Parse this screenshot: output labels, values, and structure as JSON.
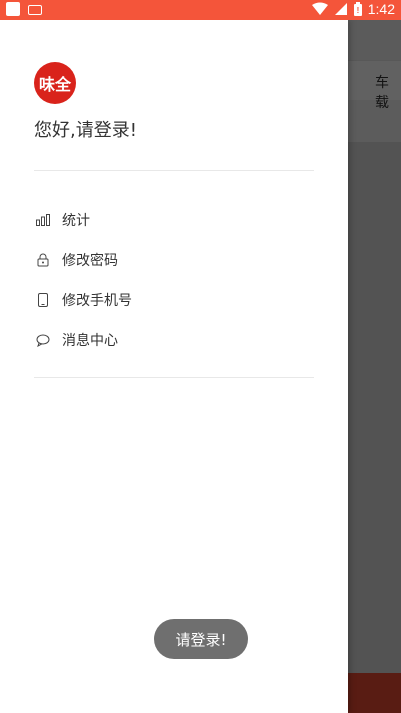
{
  "status_bar": {
    "time": "1:42",
    "icons": [
      "wifi-icon",
      "signal-icon",
      "battery-icon"
    ]
  },
  "background": {
    "tab_label": "车载"
  },
  "drawer": {
    "avatar_text": "味全",
    "greeting": "您好,请登录!",
    "menu": [
      {
        "label": "统计",
        "icon": "bar-chart-icon"
      },
      {
        "label": "修改密码",
        "icon": "lock-icon"
      },
      {
        "label": "修改手机号",
        "icon": "phone-icon"
      },
      {
        "label": "消息中心",
        "icon": "chat-icon"
      }
    ]
  },
  "toast": {
    "message": "请登录!"
  },
  "colors": {
    "accent": "#f4553a",
    "avatar_red": "#d9231b",
    "toast_bg": "#6f6f6f"
  }
}
